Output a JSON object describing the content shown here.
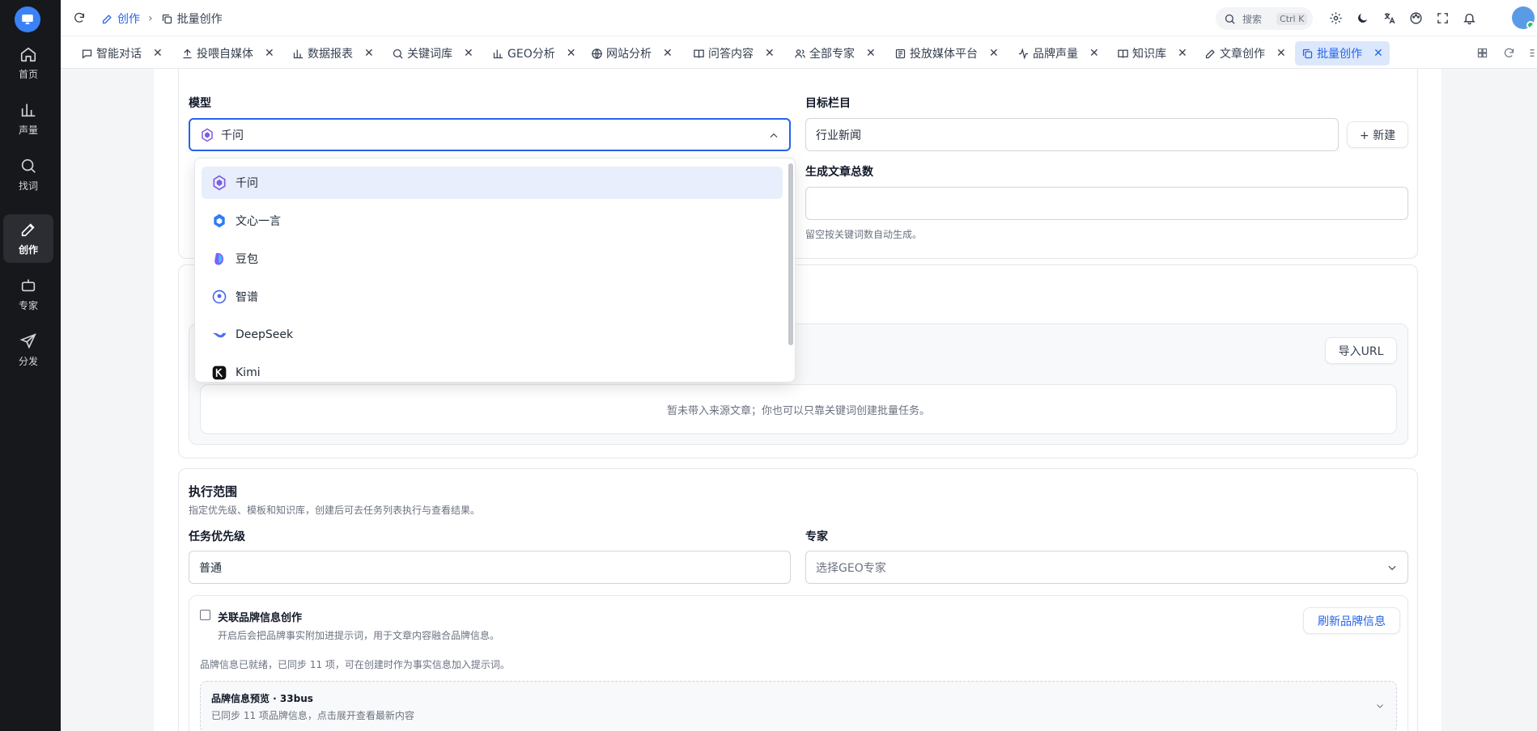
{
  "sidebar": {
    "items": [
      {
        "label": "首页",
        "icon": "home-icon"
      },
      {
        "label": "声量",
        "icon": "bar-chart-icon"
      },
      {
        "label": "找词",
        "icon": "search-icon"
      },
      {
        "label": "创作",
        "icon": "edit-icon",
        "active": true
      },
      {
        "label": "专家",
        "icon": "bot-icon"
      },
      {
        "label": "分发",
        "icon": "send-icon"
      }
    ]
  },
  "header": {
    "breadcrumb": [
      "创作",
      "批量创作"
    ],
    "search_placeholder": "搜索",
    "search_shortcut": "Ctrl K"
  },
  "tabs": [
    {
      "label": "智能对话",
      "icon": "chat-icon"
    },
    {
      "label": "投喂自媒体",
      "icon": "upload-icon"
    },
    {
      "label": "数据报表",
      "icon": "bar-chart-icon"
    },
    {
      "label": "关键词库",
      "icon": "search-icon"
    },
    {
      "label": "GEO分析",
      "icon": "bar-chart-icon"
    },
    {
      "label": "网站分析",
      "icon": "globe-icon"
    },
    {
      "label": "问答内容",
      "icon": "book-icon"
    },
    {
      "label": "全部专家",
      "icon": "users-icon"
    },
    {
      "label": "投放媒体平台",
      "icon": "newspaper-icon"
    },
    {
      "label": "品牌声量",
      "icon": "activity-icon"
    },
    {
      "label": "知识库",
      "icon": "book-icon"
    },
    {
      "label": "文章创作",
      "icon": "edit-icon"
    },
    {
      "label": "批量创作",
      "icon": "copy-icon",
      "active": true
    }
  ],
  "form": {
    "model_label": "模型",
    "model_value": "千问",
    "target_label": "目标栏目",
    "target_value": "行业新闻",
    "new_button": "+ 新建",
    "total_label": "生成文章总数",
    "total_hint": "留空按关键词数自动生成。",
    "import_url_button": "导入URL",
    "empty_source_text": "暂未带入来源文章；你也可以只靠关键词创建批量任务。"
  },
  "model_options": [
    {
      "label": "千问",
      "icon": "qwen-icon",
      "selected": true
    },
    {
      "label": "文心一言",
      "icon": "wenxin-icon"
    },
    {
      "label": "豆包",
      "icon": "doubao-icon"
    },
    {
      "label": "智谱",
      "icon": "zhipu-icon"
    },
    {
      "label": "DeepSeek",
      "icon": "deepseek-icon"
    },
    {
      "label": "Kimi",
      "icon": "kimi-icon"
    }
  ],
  "scope": {
    "title": "执行范围",
    "description": "指定优先级、模板和知识库，创建后可去任务列表执行与查看结果。",
    "priority_label": "任务优先级",
    "priority_value": "普通",
    "expert_label": "专家",
    "expert_placeholder": "选择GEO专家",
    "brand_checkbox_label": "关联品牌信息创作",
    "brand_checkbox_desc": "开启后会把品牌事实附加进提示词，用于文章内容融合品牌信息。",
    "refresh_brand_button": "刷新品牌信息",
    "brand_status": "品牌信息已就绪，已同步 11 项，可在创建时作为事实信息加入提示词。",
    "preview_title": "品牌信息预览 · 33bus",
    "preview_desc": "已同步 11 项品牌信息，点击展开查看最新内容"
  },
  "colors": {
    "accent": "#2563eb",
    "sidebar_bg": "#17181c"
  }
}
